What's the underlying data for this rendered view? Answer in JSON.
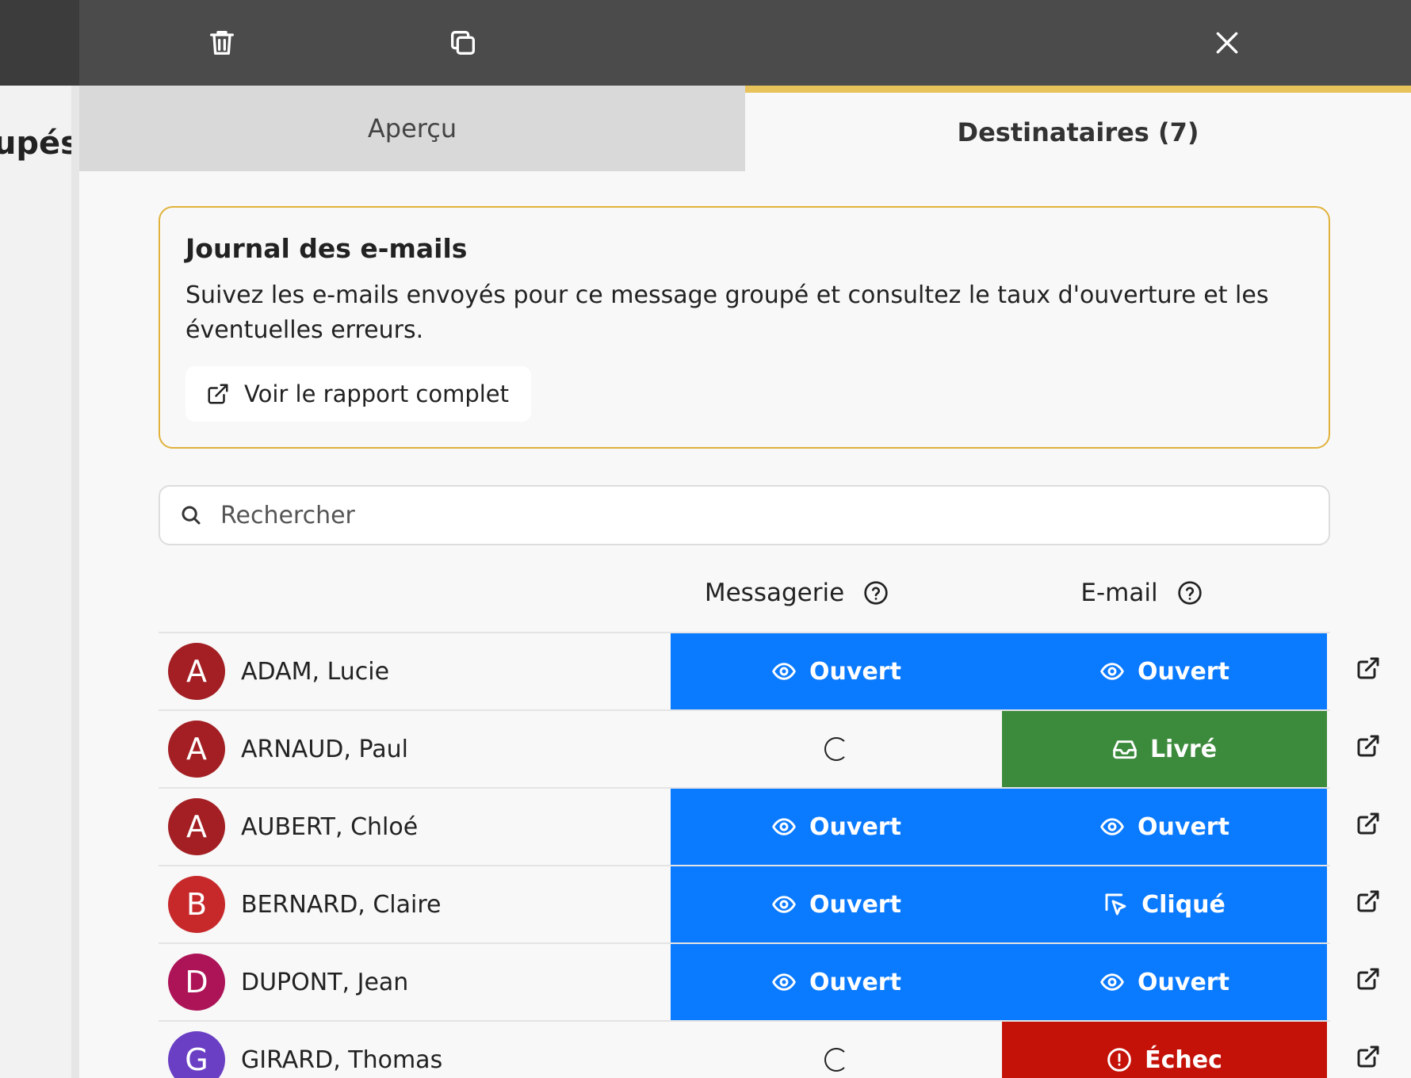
{
  "background": {
    "heading_fragment": "roupés"
  },
  "toolbar": {
    "delete_icon": "trash-icon",
    "duplicate_icon": "copy-icon",
    "close_icon": "close-icon"
  },
  "tabs": [
    {
      "label": "Aperçu",
      "active": false
    },
    {
      "label": "Destinataires (7)",
      "active": true
    }
  ],
  "accent_color": "#e8c35c",
  "card": {
    "title": "Journal des e-mails",
    "description": "Suivez les e-mails envoyés pour ce message groupé et consultez le taux d'ouverture et les éventuelles erreurs.",
    "report_button": "Voir le rapport complet"
  },
  "search": {
    "placeholder": "Rechercher"
  },
  "columns": {
    "messagerie": "Messagerie",
    "email": "E-mail"
  },
  "status_colors": {
    "opened": "#0a7aff",
    "delivered": "#3c8a3c",
    "failed": "#c41208"
  },
  "recipients": [
    {
      "initial": "A",
      "avatar_color": "#a31f23",
      "name": "ADAM, Lucie",
      "messagerie": {
        "status": "opened",
        "label": "Ouvert",
        "icon": "eye-icon"
      },
      "email": {
        "status": "opened",
        "label": "Ouvert",
        "icon": "eye-icon"
      }
    },
    {
      "initial": "A",
      "avatar_color": "#a31f23",
      "name": "ARNAUD, Paul",
      "messagerie": {
        "status": "pending",
        "label": "",
        "icon": "spinner-icon"
      },
      "email": {
        "status": "delivered",
        "label": "Livré",
        "icon": "inbox-icon"
      }
    },
    {
      "initial": "A",
      "avatar_color": "#a31f23",
      "name": "AUBERT, Chloé",
      "messagerie": {
        "status": "opened",
        "label": "Ouvert",
        "icon": "eye-icon"
      },
      "email": {
        "status": "opened",
        "label": "Ouvert",
        "icon": "eye-icon"
      }
    },
    {
      "initial": "B",
      "avatar_color": "#c7292b",
      "name": "BERNARD, Claire",
      "messagerie": {
        "status": "opened",
        "label": "Ouvert",
        "icon": "eye-icon"
      },
      "email": {
        "status": "clicked",
        "label": "Cliqué",
        "icon": "cursor-click-icon"
      }
    },
    {
      "initial": "D",
      "avatar_color": "#ad1457",
      "name": "DUPONT, Jean",
      "messagerie": {
        "status": "opened",
        "label": "Ouvert",
        "icon": "eye-icon"
      },
      "email": {
        "status": "opened",
        "label": "Ouvert",
        "icon": "eye-icon"
      }
    },
    {
      "initial": "G",
      "avatar_color": "#6a3fc4",
      "name": "GIRARD, Thomas",
      "messagerie": {
        "status": "pending",
        "label": "",
        "icon": "spinner-icon"
      },
      "email": {
        "status": "failed",
        "label": "Échec",
        "icon": "alert-circle-icon"
      }
    }
  ]
}
